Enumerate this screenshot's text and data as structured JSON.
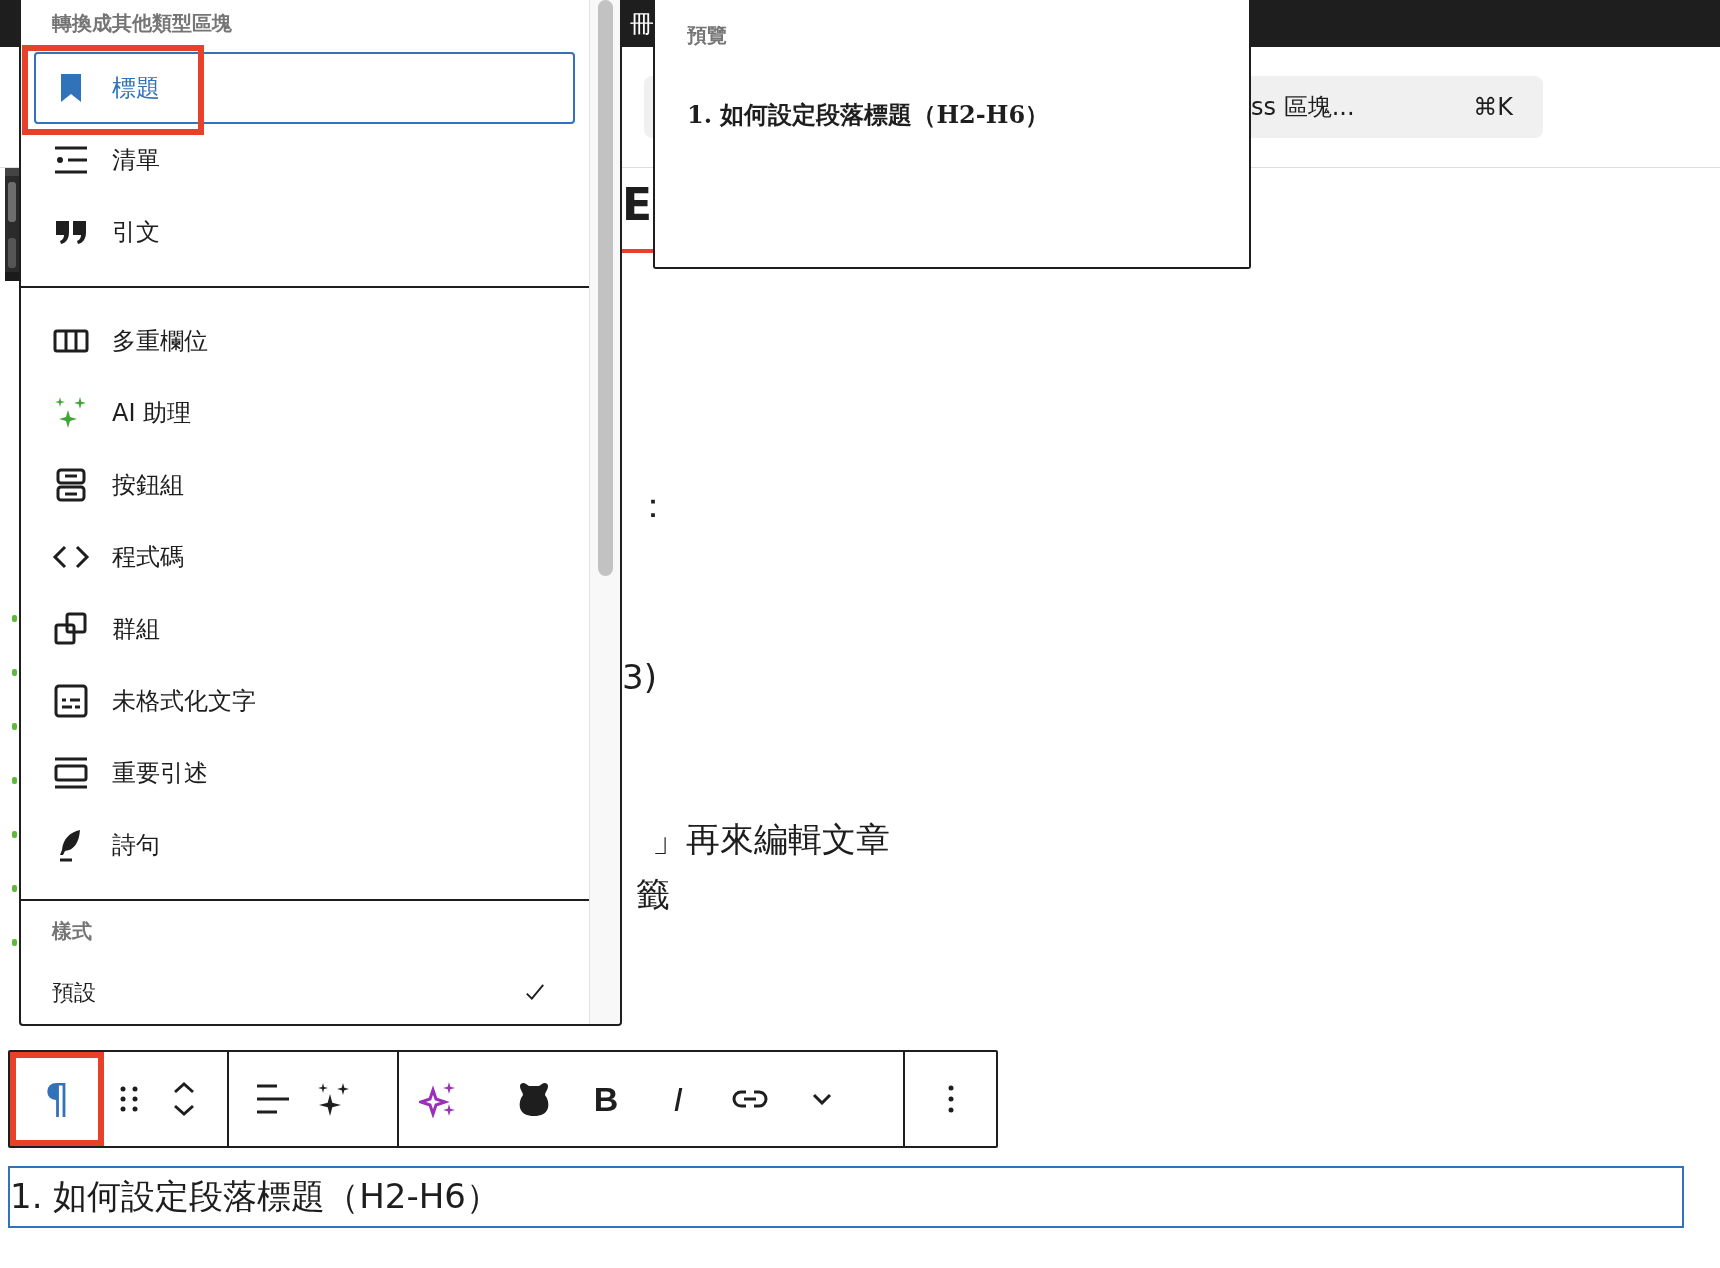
{
  "top_bar": {
    "text": "冊"
  },
  "search": {
    "text": "ss 區塊...",
    "shortcut": "⌘K"
  },
  "editor": {
    "fragments": [
      {
        "kind": "title",
        "text": "E"
      },
      {
        "kind": "text",
        "text": "："
      },
      {
        "kind": "text",
        "text": "3)"
      },
      {
        "kind": "text",
        "text": "」再來編輯文章"
      },
      {
        "kind": "text",
        "text": "籤"
      }
    ]
  },
  "transform_menu": {
    "heading": "轉換成其他類型區塊",
    "groups": [
      {
        "items": [
          {
            "label": "標題",
            "selected": true,
            "highlighted": true
          },
          {
            "label": "清單",
            "selected": false,
            "highlighted": false
          },
          {
            "label": "引文",
            "selected": false,
            "highlighted": false
          }
        ]
      },
      {
        "items": [
          {
            "label": "多重欄位",
            "selected": false,
            "highlighted": false
          },
          {
            "label": "AI 助理",
            "selected": false,
            "highlighted": false
          },
          {
            "label": "按鈕組",
            "selected": false,
            "highlighted": false
          },
          {
            "label": "程式碼",
            "selected": false,
            "highlighted": false
          },
          {
            "label": "群組",
            "selected": false,
            "highlighted": false
          },
          {
            "label": "未格式化文字",
            "selected": false,
            "highlighted": false
          },
          {
            "label": "重要引述",
            "selected": false,
            "highlighted": false
          },
          {
            "label": "詩句",
            "selected": false,
            "highlighted": false
          }
        ]
      }
    ],
    "styles_heading": "樣式",
    "styles": [
      {
        "label": "預設",
        "checked": true
      }
    ]
  },
  "preview": {
    "heading": "預覽",
    "text": "1. 如何設定段落標題（H2-H6）"
  },
  "toolbar": {
    "groups": [
      {
        "items": [
          {
            "kind": "symbol",
            "label": "¶",
            "active": true,
            "highlighted": true
          },
          {
            "kind": "drag",
            "active": false,
            "highlighted": false
          },
          {
            "kind": "move",
            "active": false,
            "highlighted": false
          }
        ]
      },
      {
        "items": [
          {
            "kind": "align",
            "active": false,
            "highlighted": false
          },
          {
            "kind": "sparkles",
            "active": false,
            "highlighted": false
          }
        ]
      },
      {
        "items": [
          {
            "kind": "ai",
            "active": false,
            "highlighted": false
          },
          {
            "kind": "animal",
            "active": false,
            "highlighted": false
          },
          {
            "kind": "bold",
            "label": "B",
            "active": false,
            "highlighted": false
          },
          {
            "kind": "italic",
            "label": "I",
            "active": false,
            "highlighted": false
          },
          {
            "kind": "link",
            "active": false,
            "highlighted": false
          },
          {
            "kind": "chevron",
            "active": false,
            "highlighted": false
          }
        ]
      },
      {
        "items": [
          {
            "kind": "more",
            "active": false,
            "highlighted": false
          }
        ]
      }
    ]
  },
  "block": {
    "text": "1. 如何設定段落標題（H2-H6）"
  }
}
